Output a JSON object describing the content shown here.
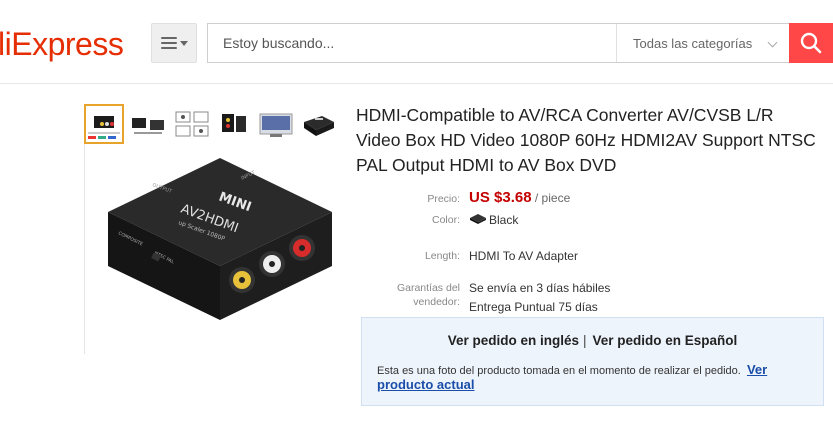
{
  "header": {
    "logo_text": "liExpress",
    "search_placeholder": "Estoy buscando...",
    "category_label": "Todas las categorías",
    "accent_color": "#ff4747"
  },
  "product": {
    "title": "HDMI-Compatible to AV/RCA Converter AV/CVSB L/R Video Box HD Video 1080P 60Hz HDMI2AV Support NTSC PAL Output HDMI to AV Box DVD",
    "image_label_top": "MINI",
    "image_label_main": "AV2HDMI",
    "image_label_sub": "up Scaler 1080P",
    "image_label_input": "INPUT",
    "image_label_output": "OUTPUT",
    "image_label_left": "COMPOSITE",
    "image_label_ntsc": "NTSC",
    "image_label_pal": "PAL",
    "price_label": "Precio:",
    "price": "US $3.68",
    "price_unit": "/ piece",
    "color_label": "Color:",
    "color_value": "Black",
    "length_label": "Length:",
    "length_value": "HDMI To AV Adapter",
    "warranty_label_1": "Garantías del",
    "warranty_label_2": "vendedor:",
    "warranty_value_1": "Se envía en 3 días hábiles",
    "warranty_value_2": "Entrega Puntual 75 días"
  },
  "order_box": {
    "link_english": "Ver pedido en inglés",
    "separator": "|",
    "link_spanish": "Ver pedido en Español",
    "note": "Esta es una foto del producto tomada en el momento de realizar el pedido.",
    "current_link": "Ver producto actual"
  }
}
